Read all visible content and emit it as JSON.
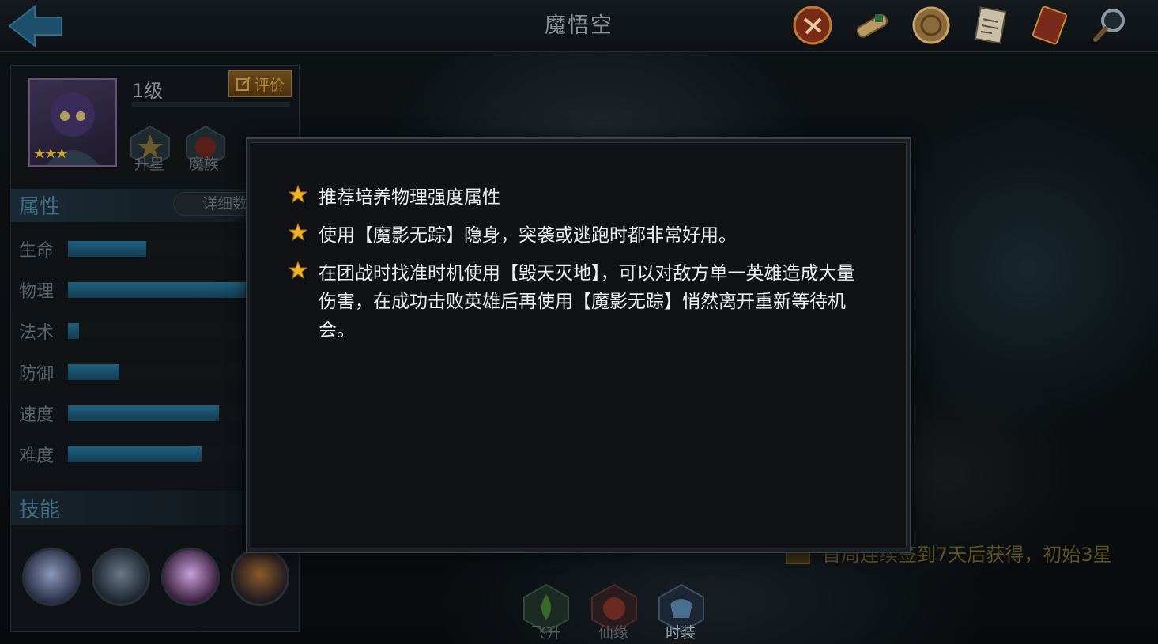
{
  "header": {
    "title": "魔悟空",
    "icons": [
      "trial-seal-icon",
      "scroll-icon",
      "coin-seal-icon",
      "document-icon",
      "book-icon",
      "magnifier-icon"
    ]
  },
  "hero_panel": {
    "level": "1级",
    "rate_label": "评价",
    "star_rating": 3,
    "badges": [
      {
        "label": "升星",
        "icon": "star-badge-icon"
      },
      {
        "label": "魔族",
        "icon": "faction-badge-icon"
      }
    ],
    "attributes_title": "属性",
    "detail_label": "详细数",
    "stats": [
      {
        "label": "生命",
        "fill": 0.44
      },
      {
        "label": "物理",
        "fill": 1.0
      },
      {
        "label": "法术",
        "fill": 0.06
      },
      {
        "label": "防御",
        "fill": 0.29
      },
      {
        "label": "速度",
        "fill": 0.85
      },
      {
        "label": "难度",
        "fill": 0.75
      }
    ],
    "skills_title": "技能"
  },
  "unlock_text": "首周连续签到7天后获得，初始3星",
  "bottom_buttons": [
    {
      "label": "飞升"
    },
    {
      "label": "仙缘"
    },
    {
      "label": "时装"
    }
  ],
  "modal": {
    "tips": [
      "推荐培养物理强度属性",
      "使用【魔影无踪】隐身，突袭或逃跑时都非常好用。",
      "在团战时找准时机使用【毁天灭地】，可以对敌方单一英雄造成大量伤害，在成功击败英雄后再使用【魔影无踪】悄然离开重新等待机会。"
    ]
  }
}
